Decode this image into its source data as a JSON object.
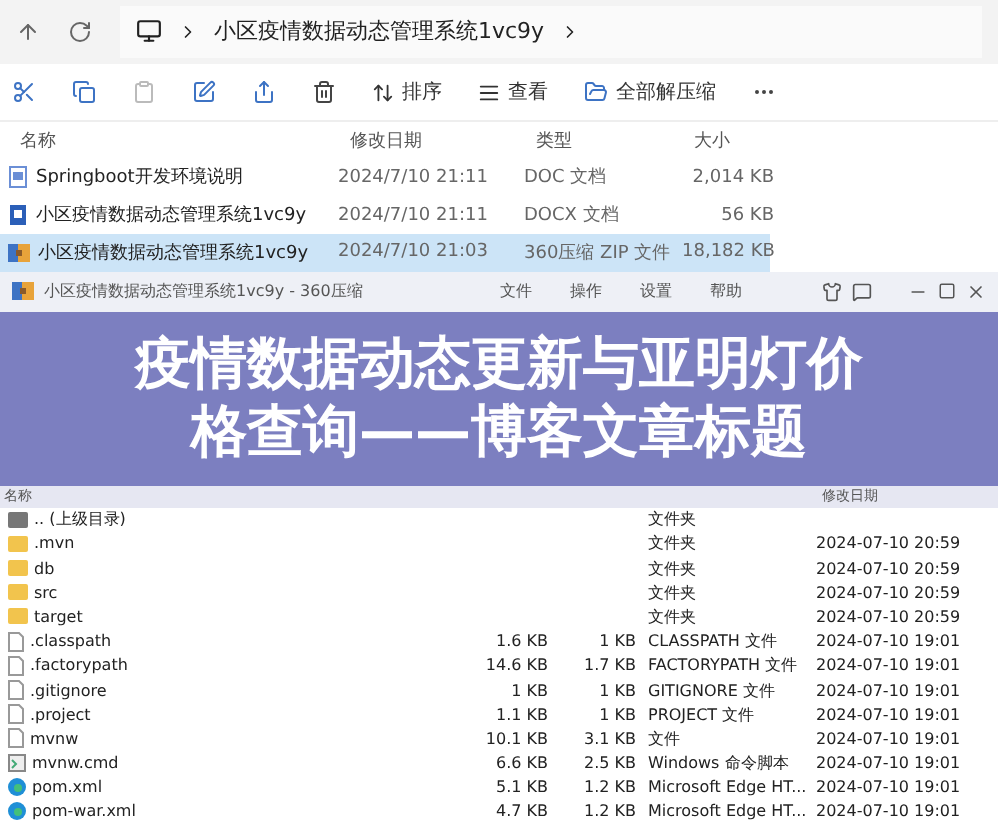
{
  "explorer": {
    "breadcrumb": "小区疫情数据动态管理系统1vc9y",
    "toolbar": [
      {
        "label": "排序",
        "kind": "sort"
      },
      {
        "label": "查看",
        "kind": "view"
      },
      {
        "label": "全部解压缩",
        "kind": "extract"
      }
    ],
    "columns": [
      "名称",
      "修改日期",
      "类型",
      "大小"
    ],
    "files": [
      {
        "kind": "doc",
        "name": "Springboot开发环境说明",
        "date": "2024/7/10 21:11",
        "type": "DOC 文档",
        "size": "2,014 KB",
        "selected": false
      },
      {
        "kind": "docx",
        "name": "小区疫情数据动态管理系统1vc9y",
        "date": "2024/7/10 21:11",
        "type": "DOCX 文档",
        "size": "56 KB",
        "selected": false
      },
      {
        "kind": "zip",
        "name": "小区疫情数据动态管理系统1vc9y",
        "date": "2024/7/10 21:03",
        "type": "360压缩 ZIP 文件",
        "size": "18,182 KB",
        "selected": true
      }
    ]
  },
  "archive": {
    "title": "小区疫情数据动态管理系统1vc9y - 360压缩",
    "menus": [
      "文件",
      "操作",
      "设置",
      "帮助"
    ],
    "columns": [
      "名称",
      "修改日期"
    ],
    "entries": [
      {
        "kind": "parent",
        "name": ".. (上级目录)",
        "type": "文件夹"
      },
      {
        "kind": "folder",
        "name": ".mvn",
        "type": "文件夹",
        "date": "2024-07-10 20:59"
      },
      {
        "kind": "folder",
        "name": "db",
        "type": "文件夹",
        "date": "2024-07-10 20:59"
      },
      {
        "kind": "folder",
        "name": "src",
        "type": "文件夹",
        "date": "2024-07-10 20:59"
      },
      {
        "kind": "folder",
        "name": "target",
        "type": "文件夹",
        "date": "2024-07-10 20:59"
      },
      {
        "kind": "file",
        "name": ".classpath",
        "size": "1.6 KB",
        "packed": "1 KB",
        "type": "CLASSPATH 文件",
        "date": "2024-07-10 19:01"
      },
      {
        "kind": "file",
        "name": ".factorypath",
        "size": "14.6 KB",
        "packed": "1.7 KB",
        "type": "FACTORYPATH 文件",
        "date": "2024-07-10 19:01"
      },
      {
        "kind": "file",
        "name": ".gitignore",
        "size": "1 KB",
        "packed": "1 KB",
        "type": "GITIGNORE 文件",
        "date": "2024-07-10 19:01"
      },
      {
        "kind": "file",
        "name": ".project",
        "size": "1.1 KB",
        "packed": "1 KB",
        "type": "PROJECT 文件",
        "date": "2024-07-10 19:01"
      },
      {
        "kind": "file",
        "name": "mvnw",
        "size": "10.1 KB",
        "packed": "3.1 KB",
        "type": "文件",
        "date": "2024-07-10 19:01"
      },
      {
        "kind": "script",
        "name": "mvnw.cmd",
        "size": "6.6 KB",
        "packed": "2.5 KB",
        "type": "Windows 命令脚本",
        "date": "2024-07-10 19:01"
      },
      {
        "kind": "edge",
        "name": "pom.xml",
        "size": "5.1 KB",
        "packed": "1.2 KB",
        "type": "Microsoft Edge HT...",
        "date": "2024-07-10 19:01"
      },
      {
        "kind": "edge",
        "name": "pom-war.xml",
        "size": "4.7 KB",
        "packed": "1.2 KB",
        "type": "Microsoft Edge HT...",
        "date": "2024-07-10 19:01"
      }
    ]
  },
  "banner": {
    "lines": [
      "疫情数据动态更新与亚明灯价",
      "格查询——博客文章标题"
    ]
  }
}
